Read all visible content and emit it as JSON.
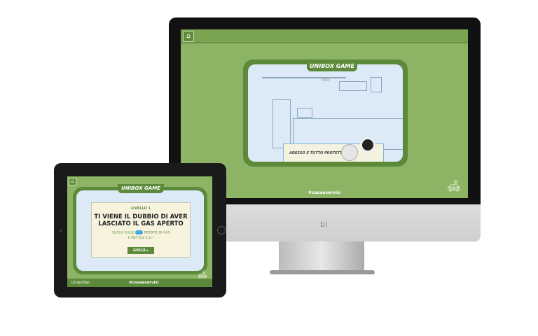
{
  "monitor": {
    "title": "UNIBOX GAME",
    "banner_text": "ADESSO È TUTTO PROTETTO!",
    "hashtag": "#casaeservizi",
    "brand_mark": "bi",
    "icons": [
      "home-icon",
      "sofa-lamp-icon"
    ]
  },
  "tablet": {
    "title": "UNIBOX GAME",
    "level": "LIVELLO 1",
    "question": "TI VIENE IL DUBBIO DI AVER LASCIATO IL GAS APERTO",
    "hint_before": "CLICCA SULLE",
    "hint_after": "PERDITE DI GAS",
    "hint_line2": "E METTILE K.O.!",
    "play_label": "GIOCA",
    "brand": "UnipolSai",
    "hashtag": "#casaeservizi"
  },
  "colors": {
    "green": "#8cb464",
    "dark_green": "#5c8a3a",
    "light_blue": "#dbeaf6",
    "gas_blue": "#4aa8e0"
  }
}
